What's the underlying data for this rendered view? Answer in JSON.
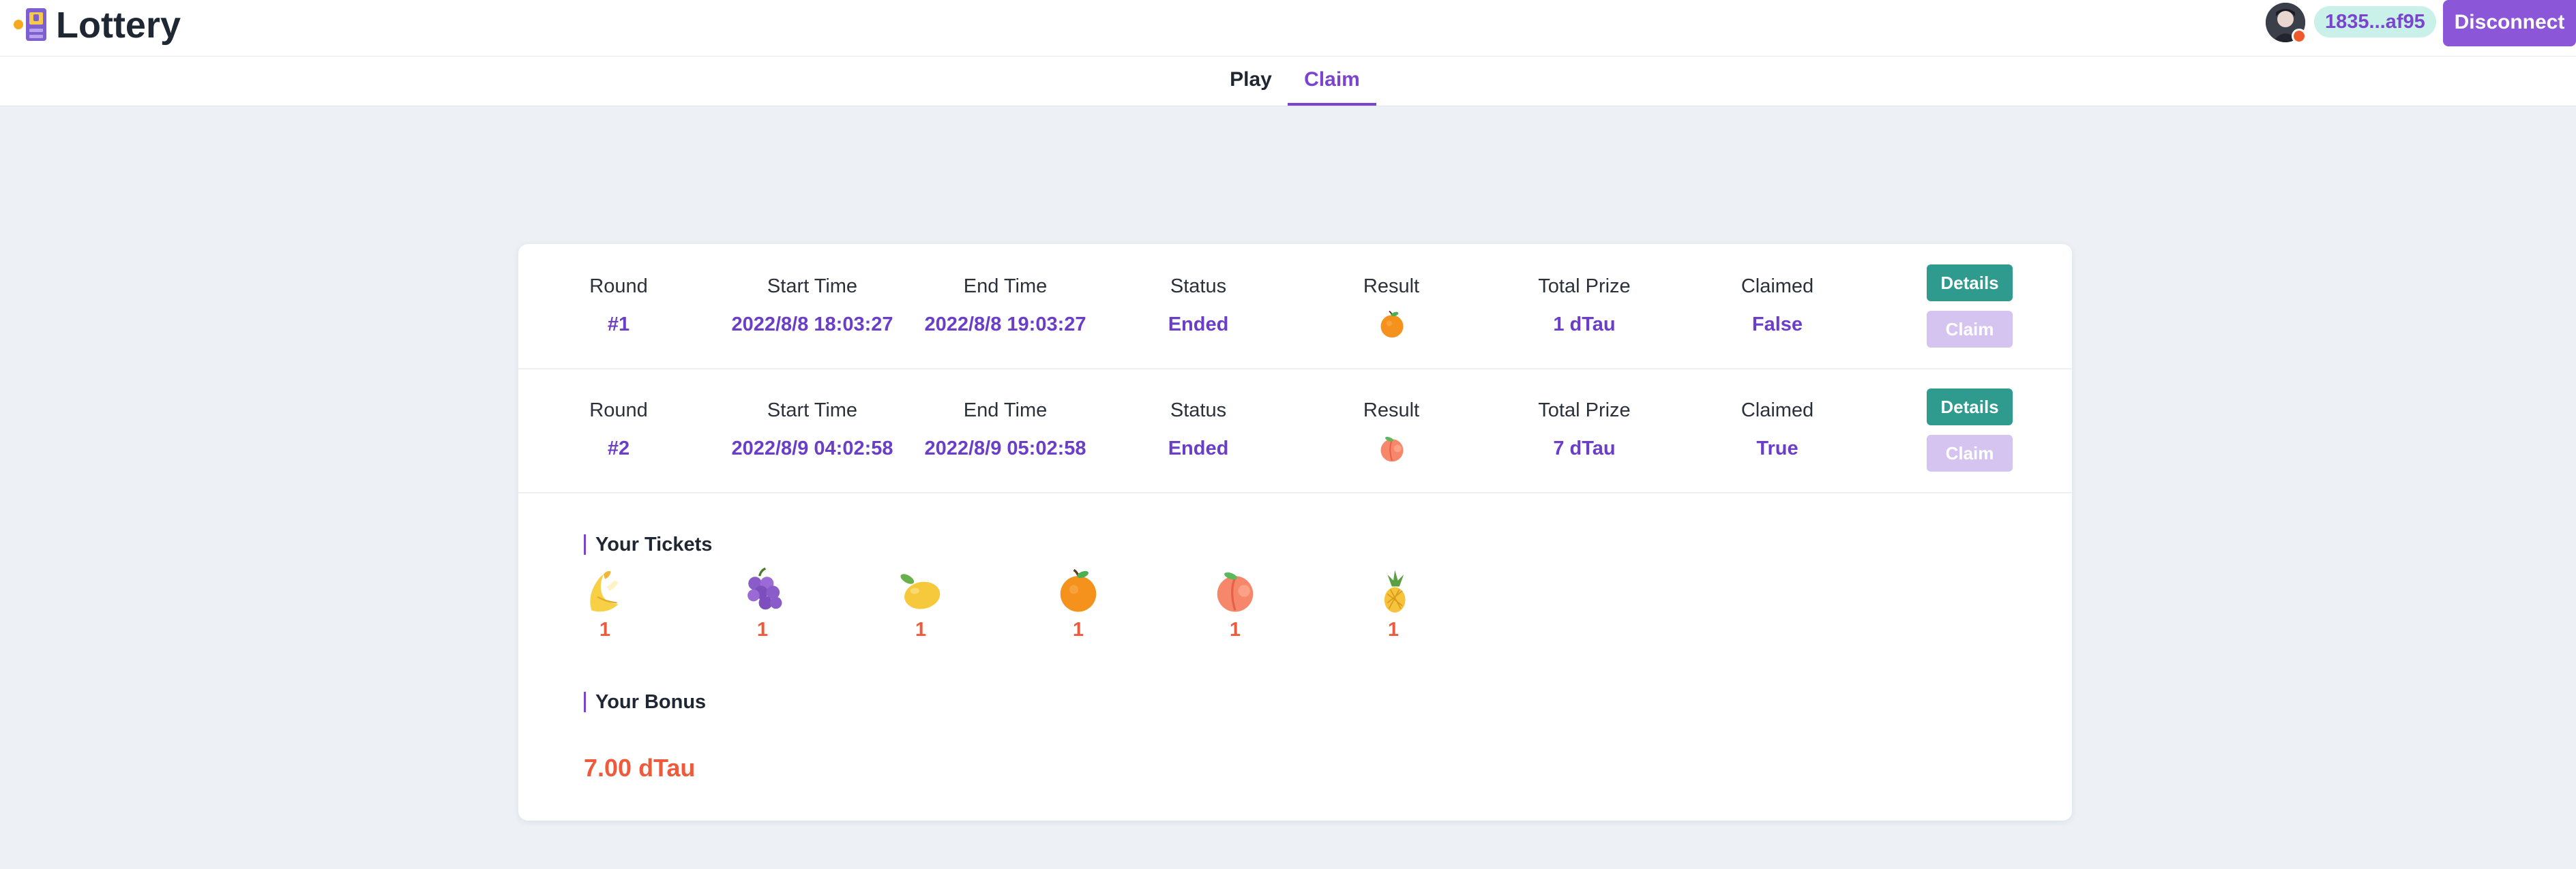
{
  "app": {
    "title": "Lottery"
  },
  "wallet": {
    "address": "1835...af95",
    "disconnect_label": "Disconnect"
  },
  "tabs": [
    {
      "label": "Play",
      "active": false
    },
    {
      "label": "Claim",
      "active": true
    }
  ],
  "columns": {
    "round": "Round",
    "start_time": "Start Time",
    "end_time": "End Time",
    "status": "Status",
    "result": "Result",
    "total_prize": "Total Prize",
    "claimed": "Claimed"
  },
  "rounds": [
    {
      "round": "#1",
      "start_time": "2022/8/8 18:03:27",
      "end_time": "2022/8/8 19:03:27",
      "status": "Ended",
      "result_icon": "orange-icon",
      "total_prize": "1 dTau",
      "claimed": "False",
      "details_label": "Details",
      "claim_label": "Claim"
    },
    {
      "round": "#2",
      "start_time": "2022/8/9 04:02:58",
      "end_time": "2022/8/9 05:02:58",
      "status": "Ended",
      "result_icon": "peach-icon",
      "total_prize": "7 dTau",
      "claimed": "True",
      "details_label": "Details",
      "claim_label": "Claim"
    }
  ],
  "tickets": {
    "heading": "Your Tickets",
    "items": [
      {
        "icon": "banana-icon",
        "count": "1"
      },
      {
        "icon": "grape-icon",
        "count": "1"
      },
      {
        "icon": "lemon-icon",
        "count": "1"
      },
      {
        "icon": "orange-icon",
        "count": "1"
      },
      {
        "icon": "peach-icon",
        "count": "1"
      },
      {
        "icon": "pineapple-icon",
        "count": "1"
      }
    ]
  },
  "bonus": {
    "heading": "Your Bonus",
    "value": "7.00 dTau"
  },
  "colors": {
    "accent": "#7a44d1",
    "details_button": "#2f9a8e",
    "claim_button_disabled": "#d5c4f0",
    "count_red": "#ee5a3c",
    "address_pill": "#c9f1ea"
  }
}
